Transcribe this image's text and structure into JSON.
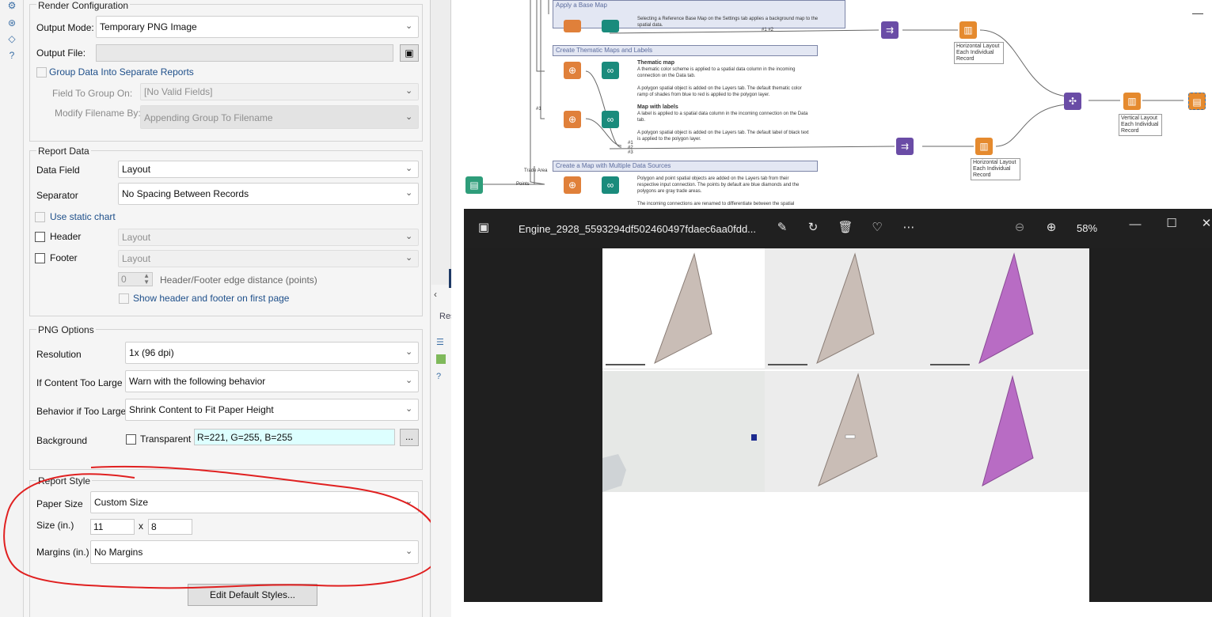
{
  "render_config": {
    "title": "Render Configuration",
    "output_mode_label": "Output Mode:",
    "output_mode_value": "Temporary PNG Image",
    "output_file_label": "Output File:",
    "group_data_label": "Group Data Into Separate Reports",
    "field_to_group_label": "Field To Group On:",
    "field_to_group_value": "[No Valid Fields]",
    "modify_filename_label": "Modify Filename By:",
    "modify_filename_value": "Appending Group To Filename"
  },
  "report_data": {
    "title": "Report Data",
    "data_field_label": "Data Field",
    "data_field_value": "Layout",
    "separator_label": "Separator",
    "separator_value": "No Spacing Between Records",
    "static_chart_label": "Use static chart",
    "header_label": "Header",
    "header_value": "Layout",
    "footer_label": "Footer",
    "footer_value": "Layout",
    "edge_distance_value": "0",
    "edge_distance_label": "Header/Footer edge distance (points)",
    "show_first_page_label": "Show header and footer on first page"
  },
  "png_options": {
    "title": "PNG Options",
    "resolution_label": "Resolution",
    "resolution_value": "1x (96 dpi)",
    "too_large_label": "If Content Too Large",
    "too_large_value": "Warn with the following behavior",
    "behavior_label": "Behavior if Too Large",
    "behavior_value": "Shrink Content to Fit Paper Height",
    "background_label": "Background",
    "transparent_label": "Transparent",
    "color_value": "R=221, G=255, B=255",
    "ellipsis": "..."
  },
  "report_style": {
    "title": "Report Style",
    "paper_size_label": "Paper Size",
    "paper_size_value": "Custom Size",
    "size_label": "Size (in.)",
    "width_value": "11",
    "times": "x",
    "height_value": "8",
    "margins_label": "Margins (in.)",
    "margins_value": "No Margins",
    "edit_styles_label": "Edit Default Styles..."
  },
  "results": {
    "results_label": "Result",
    "re_label": "Re"
  },
  "workflow": {
    "box_base_map": "Apply a Base Map",
    "desc_base_map": "Selecting a Reference Base Map on the Settings tab applies a background map to the spatial data.",
    "box_thematic": "Create Thematic Maps and Labels",
    "thematic_title": "Thematic map",
    "thematic_desc1": "A thematic color scheme is applied to a spatial data column in the incoming connection on the Data tab.",
    "thematic_desc2": "A polygon spatial object is added on the Layers tab. The default thematic color ramp of shades from blue to red is applied to the polygon layer.",
    "labels_title": "Map with labels",
    "labels_desc1": "A label is applied to a spatial data column in the incoming connection on the Data tab.",
    "labels_desc2": "A polygon spatial object is added on the Layers tab. The default label of black text is applied to the polygon layer.",
    "box_multiple": "Create a Map with Multiple Data Sources",
    "multiple_desc1": "Polygon and point spatial objects are added on the Layers tab from their respective input connection. The points by default are blue diamonds and the polygons are gray trade areas.",
    "multiple_desc2": "The incoming connections are renamed to differentiate between the spatial",
    "horizontal_label_1": "Horizontal Layout Each Individual Record",
    "horizontal_label_2": "Horizontal Layout Each Individual Record",
    "vertical_label": "Vertical Layout Each Individual Record",
    "trade_area": "Trade Area",
    "points": "Points",
    "hash1": "#1",
    "hash2": "#2",
    "hash3": "#3",
    "hash_pair": "#1 #2"
  },
  "viewer": {
    "filename": "Engine_2928_5593294df502460497fdaec6aa0fdd...",
    "zoom_level": "58%"
  },
  "colors": {
    "accent_blue": "#1e4f8a",
    "annotation_red": "#e02020",
    "color_field_bg": "#ddffff",
    "triangle_grey": "#c9bdb6",
    "triangle_purple": "#b86cc4"
  }
}
